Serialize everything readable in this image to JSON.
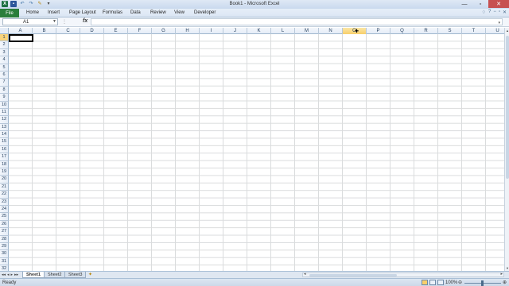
{
  "window": {
    "title": "Book1 - Microsoft Excel"
  },
  "qat": {
    "logo": "X",
    "save": "▪",
    "undo": "↶",
    "redo": "↷",
    "format": "✎",
    "more": "▾"
  },
  "ribbon": {
    "file": "File",
    "tabs": [
      "Home",
      "Insert",
      "Page Layout",
      "Formulas",
      "Data",
      "Review",
      "View",
      "Developer"
    ]
  },
  "formula_bar": {
    "name_box": "A1",
    "fx": "fx",
    "content": ""
  },
  "grid": {
    "columns": [
      "A",
      "B",
      "C",
      "D",
      "E",
      "F",
      "G",
      "H",
      "I",
      "J",
      "K",
      "L",
      "M",
      "N",
      "O",
      "P",
      "Q",
      "R",
      "S",
      "T",
      "U"
    ],
    "rows": [
      "1",
      "2",
      "3",
      "4",
      "5",
      "6",
      "7",
      "8",
      "9",
      "10",
      "11",
      "12",
      "13",
      "14",
      "15",
      "16",
      "17",
      "18",
      "19",
      "20",
      "21",
      "22",
      "23",
      "24",
      "25",
      "26",
      "27",
      "28",
      "29",
      "30",
      "31",
      "32"
    ],
    "selected_column": "O",
    "active_cell": "A1"
  },
  "sheets": [
    {
      "name": "Sheet1",
      "active": true
    },
    {
      "name": "Sheet2",
      "active": false
    },
    {
      "name": "Sheet3",
      "active": false
    }
  ],
  "status": {
    "text": "Ready",
    "zoom": "100%"
  },
  "colors": {
    "file_tab": "#2a7e3b",
    "selection": "#f8cf6b",
    "close": "#c75050"
  }
}
